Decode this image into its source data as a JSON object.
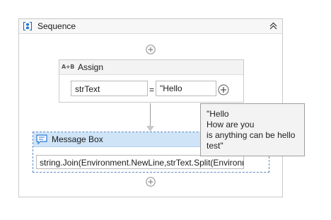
{
  "sequence": {
    "title": "Sequence",
    "icon": "sequence-icon",
    "collapse_icon": "double-chevron-up-icon"
  },
  "assign": {
    "title": "Assign",
    "icon_text": "A+B",
    "to_value": "strText",
    "equals": "=",
    "value": "\"Hello\n..."
  },
  "message_box": {
    "title": "Message Box",
    "icon": "message-box-icon",
    "text_value": "string.Join(Environment.NewLine,strText.Split(Environm"
  },
  "tooltip": {
    "text": "\"Hello\nHow are you\nis  anything can be hello test\""
  },
  "colors": {
    "selected_header": "#cfe4f7",
    "selected_border": "#5b89c8"
  }
}
